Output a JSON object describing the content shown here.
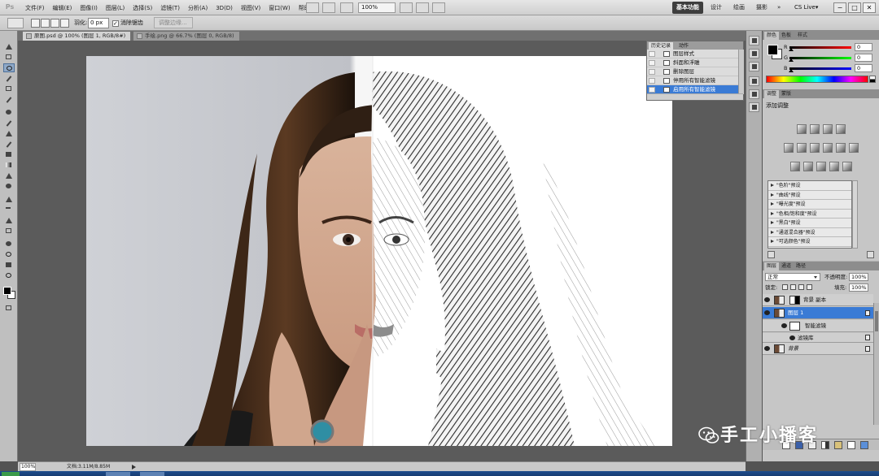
{
  "menubar": {
    "logo": "Ps",
    "items": [
      "文件(F)",
      "编辑(E)",
      "图像(I)",
      "图层(L)",
      "选择(S)",
      "滤镜(T)",
      "分析(A)",
      "3D(D)",
      "视图(V)",
      "窗口(W)",
      "帮助(H)"
    ],
    "zoom": "100%",
    "workspaces": [
      "基本功能",
      "设计",
      "绘画",
      "摄影"
    ],
    "active_workspace": "基本功能",
    "cs_live": "CS Live▾",
    "window_controls": [
      "−",
      "□",
      "✕"
    ]
  },
  "options_bar": {
    "feather_label": "羽化:",
    "feather_value": "0 px",
    "antialias_label": "消除锯齿",
    "antialias_checked": true,
    "refine_edge_button": "调整边缘..."
  },
  "tabs": [
    {
      "label": "原图.psd @ 100% (图层 1, RGB/8#)",
      "active": true
    },
    {
      "label": "手绘.png @ 66.7% (图层 0, RGB/8)",
      "active": false
    }
  ],
  "history_panel": {
    "tabs": [
      "历史记录",
      "动作"
    ],
    "rows": [
      "图层样式",
      "斜面和浮雕",
      "删除图层",
      "停用所有智能滤镜",
      "启用所有智能滤镜"
    ],
    "selected_index": 4
  },
  "color_panel": {
    "tabs": [
      "颜色",
      "色板",
      "样式"
    ],
    "channels": [
      {
        "name": "R",
        "value": "0"
      },
      {
        "name": "G",
        "value": "0"
      },
      {
        "name": "B",
        "value": "0"
      }
    ]
  },
  "adjustments_panel": {
    "tabs": [
      "调整",
      "蒙版"
    ],
    "title": "添加调整",
    "presets": [
      "\"色阶\"预设",
      "\"曲线\"预设",
      "\"曝光度\"预设",
      "\"色相/饱和度\"预设",
      "\"黑白\"预设",
      "\"通道混合器\"预设",
      "\"可选颜色\"预设"
    ]
  },
  "layers_panel": {
    "tabs": [
      "图层",
      "通道",
      "路径"
    ],
    "blend_mode": "正常",
    "opacity_label": "不透明度:",
    "opacity_value": "100%",
    "lock_label": "锁定:",
    "fill_label": "填充:",
    "fill_value": "100%",
    "layers": [
      {
        "name": "背景 副本",
        "type": "masked",
        "selected": false
      },
      {
        "name": "图层 1",
        "type": "smart",
        "selected": true
      },
      {
        "name": "智能滤镜",
        "type": "filter-mask",
        "selected": false
      },
      {
        "name": "滤镜库",
        "type": "filter",
        "selected": false
      },
      {
        "name": "背景",
        "type": "background",
        "selected": false
      }
    ]
  },
  "status_bar": {
    "zoom": "100%",
    "doc_info": "文档:3.11M/8.85M"
  },
  "watermark": {
    "text": "手工小播客"
  },
  "colors": {
    "selection_blue": "#3a7bd5",
    "panel_gray": "#c6c6c6",
    "canvas_dark": "#5b5b5b"
  }
}
